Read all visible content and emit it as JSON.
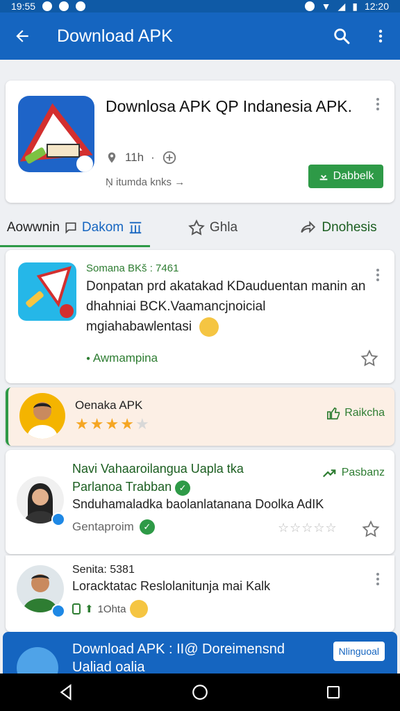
{
  "status_bar": {
    "time_left": "19:55",
    "time_right": "12:20"
  },
  "app_bar": {
    "title": "Download APK"
  },
  "app_card": {
    "name": "Downlosa APK QP Indanesia APK.",
    "size": "11h",
    "sub": "Ņ itumda knks →",
    "button_label": "Dabbelk"
  },
  "tabs": [
    {
      "label": "Aowwnin",
      "badge": "Dakom"
    },
    {
      "label": "Ghla"
    },
    {
      "label": "Dnohesis"
    }
  ],
  "post": {
    "author": "Somana BKš : 7461",
    "body": "Donpatan prd akatakad KDauduentan manin an dhahniai BCK.Vaamancjnoicial mgiahabawlentasi",
    "tag": "Awmampina"
  },
  "rating": {
    "name": "Oenaka APK",
    "stars": 4,
    "max_stars": 5,
    "action": "Raikcha"
  },
  "review": {
    "title": "Navi Vahaaroilangua Uapla tka Parlanoa Trabban",
    "body": "Snduhamaladka baolanlatanana Doolka AdIK",
    "foot": "Gentaproim",
    "action": "Pasbanz"
  },
  "comment": {
    "name": "Senita: 5381",
    "body": "Loracktatac Reslolanitunja mai Kalk",
    "foot": "1Ohta"
  },
  "banner": {
    "text": "Download APK : II@ Doreimensnd Ualiad oalia",
    "button": "Nlinguoal"
  },
  "colors": {
    "primary": "#1565c0",
    "accent_green": "#2e9a47",
    "star": "#f5a623"
  }
}
